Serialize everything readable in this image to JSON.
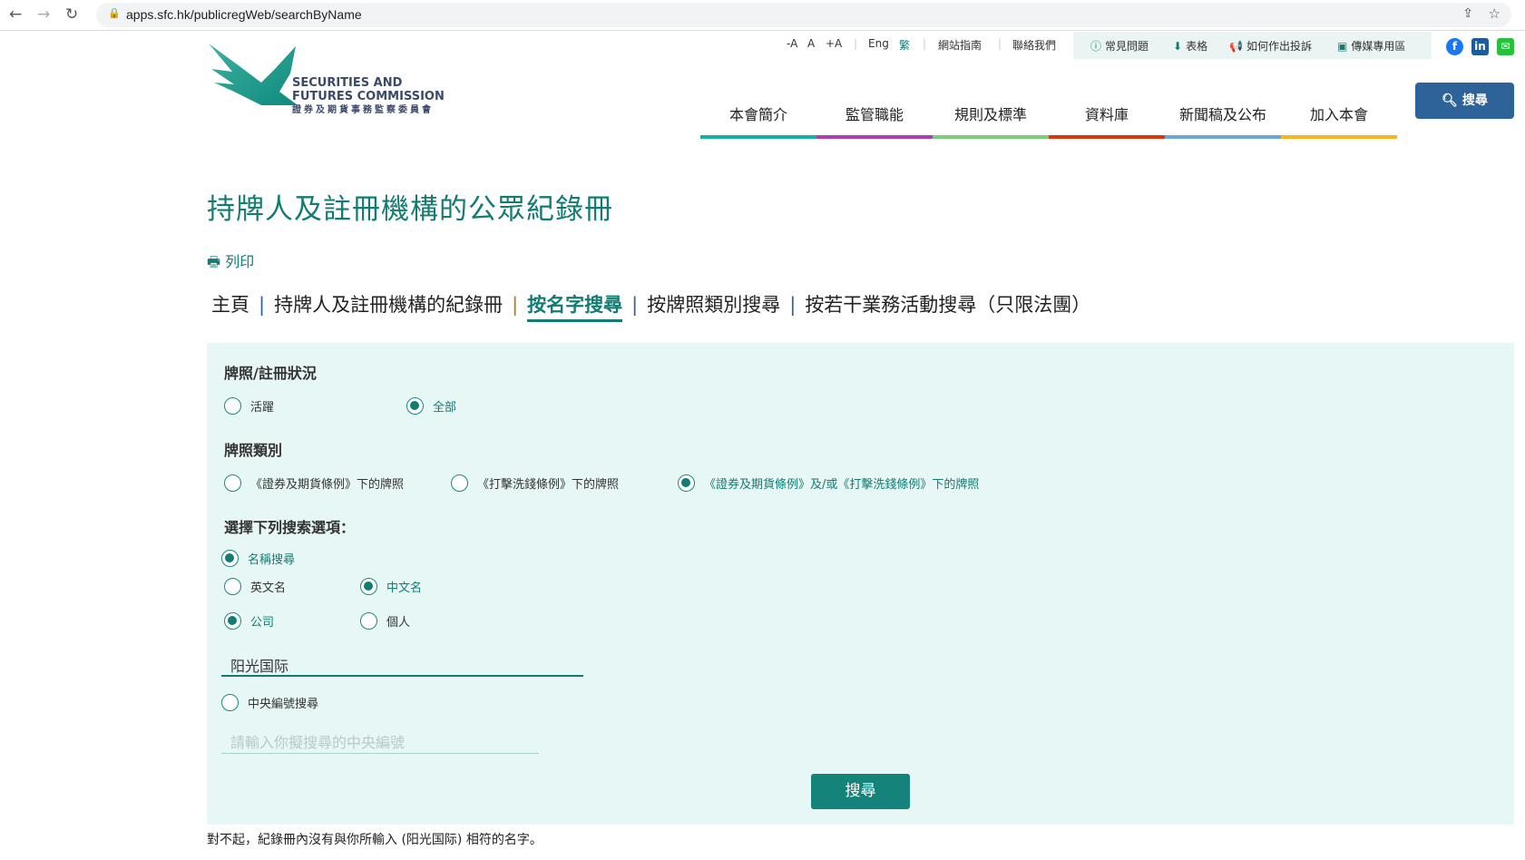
{
  "browser": {
    "url": "apps.sfc.hk/publicregWeb/searchByName"
  },
  "header": {
    "logo": {
      "line1": "SECURITIES AND",
      "line2": "FUTURES COMMISSION",
      "line3": "證券及期貨事務監察委員會"
    },
    "font_sizes": [
      "-A",
      "A",
      "+A"
    ],
    "lang_en": "Eng",
    "lang_tc": "繁",
    "links": [
      "網站指南",
      "聯絡我們"
    ],
    "quick_links": [
      {
        "icon": "question-icon",
        "label": "常見問題"
      },
      {
        "icon": "download-icon",
        "label": "表格"
      },
      {
        "icon": "megaphone-icon",
        "label": "如何作出投訴"
      },
      {
        "icon": "image-icon",
        "label": "傳媒專用區"
      }
    ],
    "social": [
      "facebook",
      "linkedin",
      "wechat"
    ],
    "search_label": "搜尋",
    "nav": [
      {
        "label": "本會簡介",
        "color": "#14b0a0"
      },
      {
        "label": "監管職能",
        "color": "#b03cb3"
      },
      {
        "label": "規則及標準",
        "color": "#7ccc7e"
      },
      {
        "label": "資料庫",
        "color": "#d9360b"
      },
      {
        "label": "新聞稿及公布",
        "color": "#66a8d6"
      },
      {
        "label": "加入本會",
        "color": "#f8b520"
      }
    ]
  },
  "page": {
    "title": "持牌人及註冊機構的公眾紀錄冊",
    "print": "列印",
    "breadcrumbs": [
      "主頁",
      "持牌人及註冊機構的紀錄冊",
      "按名字搜尋",
      "按牌照類別搜尋",
      "按若干業務活動搜尋（只限法團）"
    ],
    "active_crumb": 2
  },
  "form": {
    "status_heading": "牌照/註冊狀況",
    "status_options": [
      {
        "label": "活躍",
        "checked": false
      },
      {
        "label": "全部",
        "checked": true
      }
    ],
    "type_heading": "牌照類別",
    "type_options": [
      {
        "label": "《證券及期貨條例》下的牌照",
        "checked": false
      },
      {
        "label": "《打擊洗錢條例》下的牌照",
        "checked": false
      },
      {
        "label": "《證券及期貨條例》及/或《打擊洗錢條例》下的牌照",
        "checked": true
      }
    ],
    "search_heading": "選擇下列搜索選項：",
    "name_search": {
      "label": "名稱搜尋",
      "checked": true
    },
    "lang_options": [
      {
        "label": "英文名",
        "checked": false
      },
      {
        "label": "中文名",
        "checked": true
      }
    ],
    "entity_options": [
      {
        "label": "公司",
        "checked": true
      },
      {
        "label": "個人",
        "checked": false
      }
    ],
    "name_value": "阳光国际",
    "ce_search": {
      "label": "中央編號搜尋",
      "checked": false
    },
    "ce_placeholder": "請輸入你擬搜尋的中央編號",
    "submit": "搜尋"
  },
  "result_message": "對不起，紀錄冊內沒有與你所輸入 (阳光国际) 相符的名字。"
}
